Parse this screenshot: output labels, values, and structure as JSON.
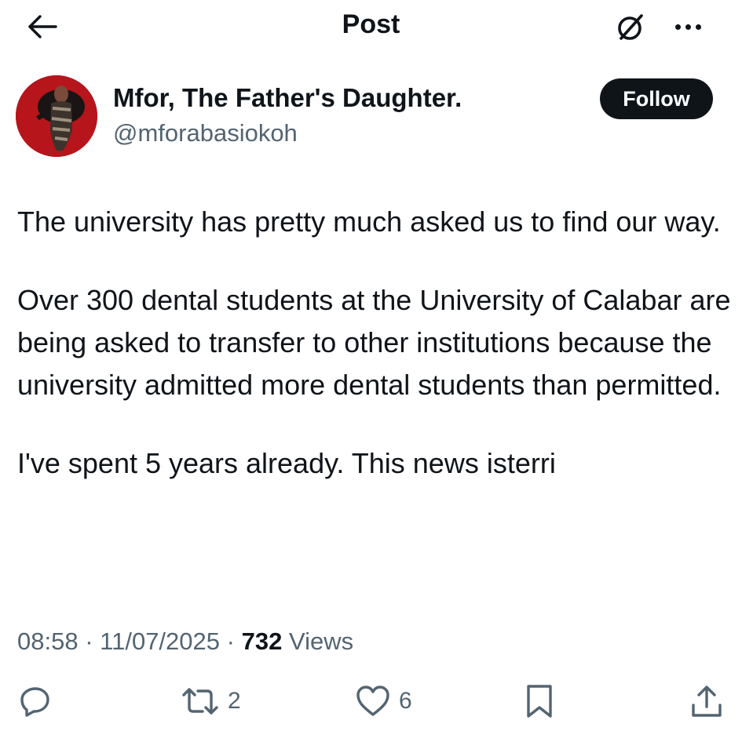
{
  "header": {
    "title": "Post",
    "back_icon": "arrow-left-icon",
    "grok_icon": "grok-icon",
    "more_icon": "more-horizontal-icon"
  },
  "author": {
    "name": "Mfor, The Father's Daughter.",
    "handle": "@mforabasiokoh",
    "follow_label": "Follow",
    "avatar_bg": "#b5151b"
  },
  "post": {
    "paragraphs": [
      "The university has pretty much asked us to find our way.",
      "Over 300 dental students at the University of Calabar are being asked to transfer to other institutions because the university admitted more dental students than permitted.",
      "I've spent 5 years already. This news isterri"
    ],
    "time": "08:58",
    "date": "11/07/2025",
    "separator": "·",
    "views_count": "732",
    "views_label": "Views"
  },
  "actions": {
    "reply_icon": "reply-icon",
    "repost_icon": "repost-icon",
    "repost_count": "2",
    "like_icon": "heart-icon",
    "like_count": "6",
    "bookmark_icon": "bookmark-icon",
    "share_icon": "share-icon"
  },
  "colors": {
    "text": "#0f1419",
    "secondary": "#536471",
    "button_bg": "#0f1419"
  }
}
